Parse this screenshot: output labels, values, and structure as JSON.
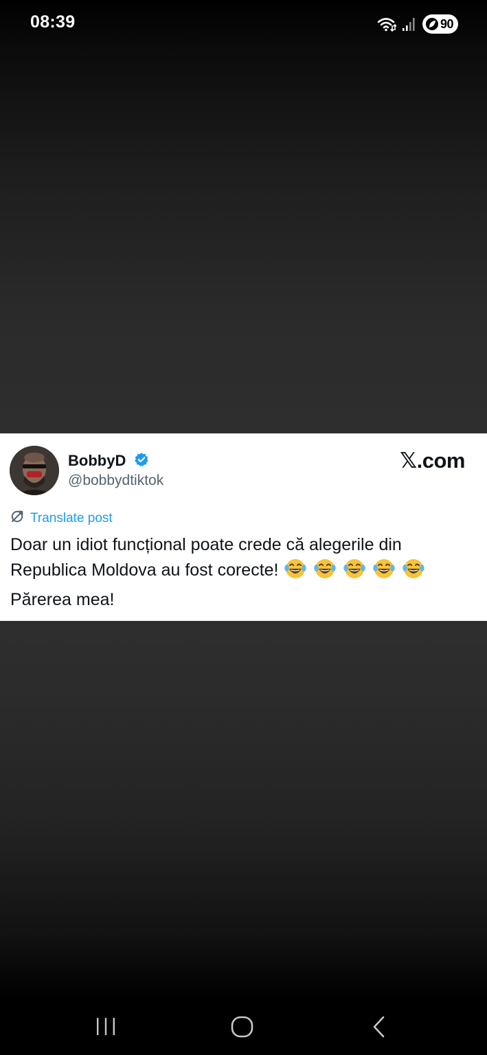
{
  "status_bar": {
    "time": "08:39",
    "battery_level": "90",
    "icons": [
      "wifi-icon",
      "signal-icon",
      "battery-saver-icon"
    ]
  },
  "post": {
    "author": {
      "name": "BobbyD",
      "handle": "@bobbydtiktok",
      "verified": true
    },
    "site": "𝕏.com",
    "translate_label": "Translate post",
    "text": {
      "line1": "Doar un idiot funcțional poate crede că alegerile din",
      "line2": "Republica Moldova au fost corecte!",
      "line3": "Părerea mea!"
    },
    "emoji": [
      "face-with-tears-of-joy",
      "face-with-tears-of-joy",
      "face-with-tears-of-joy",
      "face-with-tears-of-joy",
      "face-with-tears-of-joy"
    ]
  },
  "nav_bar": {
    "buttons": [
      "recent-apps",
      "home",
      "back"
    ]
  },
  "colors": {
    "verified_blue": "#1d9bf0",
    "handle_gray": "#536471",
    "text_dark": "#0f1419",
    "emoji_yellow": "#f6c33a"
  }
}
